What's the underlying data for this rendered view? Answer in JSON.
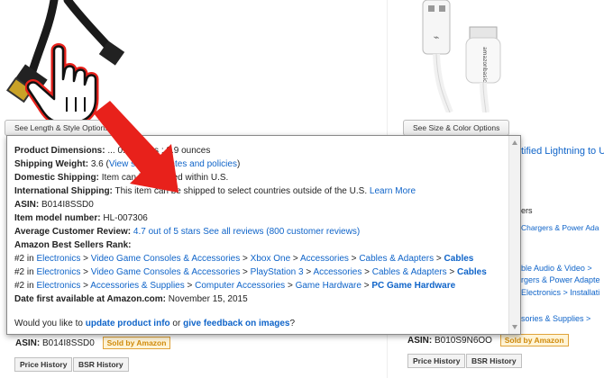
{
  "left_product": {
    "option_button": "See Length & Style Options",
    "asin_label": "ASIN:",
    "asin_value": "B014I8SSD0",
    "sold_badge": "Sold by Amazon",
    "price_history": "Price History",
    "bsr_history": "BSR History"
  },
  "right_product": {
    "option_button": "See Size & Color Options",
    "title_partial": "tified Lightning to U",
    "frag1": "ers",
    "frag2": "Chargers & Power Ada",
    "frag3a": "ble Audio & Video > ",
    "frag3b": "rgers & Power Adapte",
    "frag3c": "Electronics > Installati",
    "frag4": "sories & Supplies > ",
    "asin_label": "ASIN:",
    "asin_value": "B010S9N6OO",
    "sold_badge": "Sold by Amazon",
    "price_history": "Price History",
    "bsr_history": "BSR History",
    "cable_brand": "amazonbasics"
  },
  "popup": {
    "dims_label": "Product Dimensions:",
    "dims_value": "... 0.4 inches ; 2.9 ounces",
    "weight_label": "Shipping Weight:",
    "weight_value": "3.6",
    "weight_link": "View shipping rates and policies",
    "domestic_label": "Domestic Shipping:",
    "domestic_value": "Item can be shipped within U.S.",
    "intl_label": "International Shipping:",
    "intl_value": "This item can be shipped to select countries outside of the U.S.",
    "intl_link": "Learn More",
    "asin_label": "ASIN:",
    "asin_value": "B014I8SSD0",
    "model_label": "Item model number:",
    "model_value": "HL-007306",
    "review_label": "Average Customer Review:",
    "review_stars": "4.7 out of 5 stars",
    "review_all": "See all reviews",
    "review_count": "(800 customer reviews)",
    "bsr_label": "Amazon Best Sellers Rank:",
    "ranks": [
      {
        "rank": "#2 in",
        "path": [
          "Electronics",
          "Video Game Consoles & Accessories",
          "Xbox One",
          "Accessories",
          "Cables & Adapters"
        ],
        "leaf": "Cables"
      },
      {
        "rank": "#2 in",
        "path": [
          "Electronics",
          "Video Game Consoles & Accessories",
          "PlayStation 3",
          "Accessories",
          "Cables & Adapters"
        ],
        "leaf": "Cables"
      },
      {
        "rank": "#2 in",
        "path": [
          "Electronics",
          "Accessories & Supplies",
          "Computer Accessories",
          "Game Hardware"
        ],
        "leaf": "PC Game Hardware"
      }
    ],
    "date_label": "Date first available at Amazon.com:",
    "date_value": "November 15, 2015",
    "footer_prefix": "Would you like to",
    "footer_update": "update product info",
    "footer_or": "or",
    "footer_feedback": "give feedback on images",
    "footer_suffix": "?"
  },
  "colors": {
    "link": "#0f64c9",
    "arrow": "#e8211b",
    "badge": "#d08a0b"
  },
  "icons": [
    "hand-cursor-icon",
    "red-arrow-icon",
    "scroll-up-icon",
    "scroll-down-icon"
  ]
}
